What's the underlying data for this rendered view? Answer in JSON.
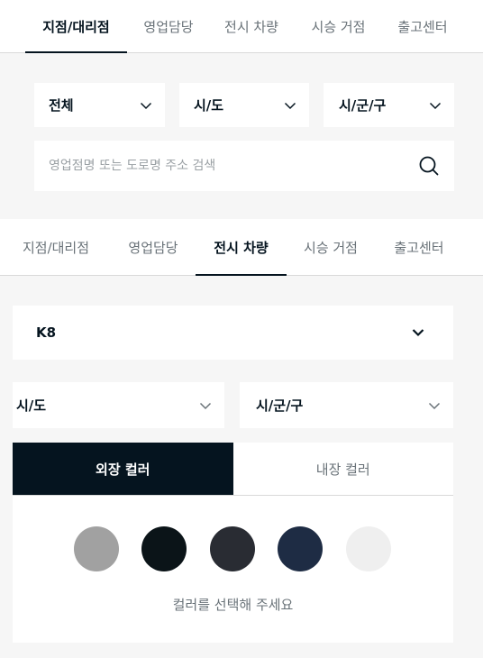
{
  "top_tabs": [
    "지점/대리점",
    "영업담당",
    "전시 차량",
    "시승 거점",
    "출고센터"
  ],
  "top_filters": {
    "type": "전체",
    "region": "시/도",
    "district": "시/군/구"
  },
  "search": {
    "placeholder": "영업점명 또는 도로명 주소 검색",
    "value": "",
    "icon": "search-icon"
  },
  "section_tabs": [
    "지점/대리점",
    "영업담당",
    "전시 차량",
    "시승 거점",
    "출고센터"
  ],
  "section_tabs_active": "전시 차량",
  "model_select": "K8",
  "region_select": "시/도",
  "district_select": "시/군/구",
  "color_tabs": [
    "외장 컬러",
    "내장 컬러"
  ],
  "color_tabs_active": "외장 컬러",
  "swatches": [
    "#a1a1a1",
    "#0b1418",
    "#292c33",
    "#1e2c44",
    "#efefef"
  ],
  "color_hint": "컬러를 선택해 주세요",
  "theme": {
    "primary": "#05141f",
    "muted": "#697278",
    "panel_bg": "#f6f6f6"
  }
}
